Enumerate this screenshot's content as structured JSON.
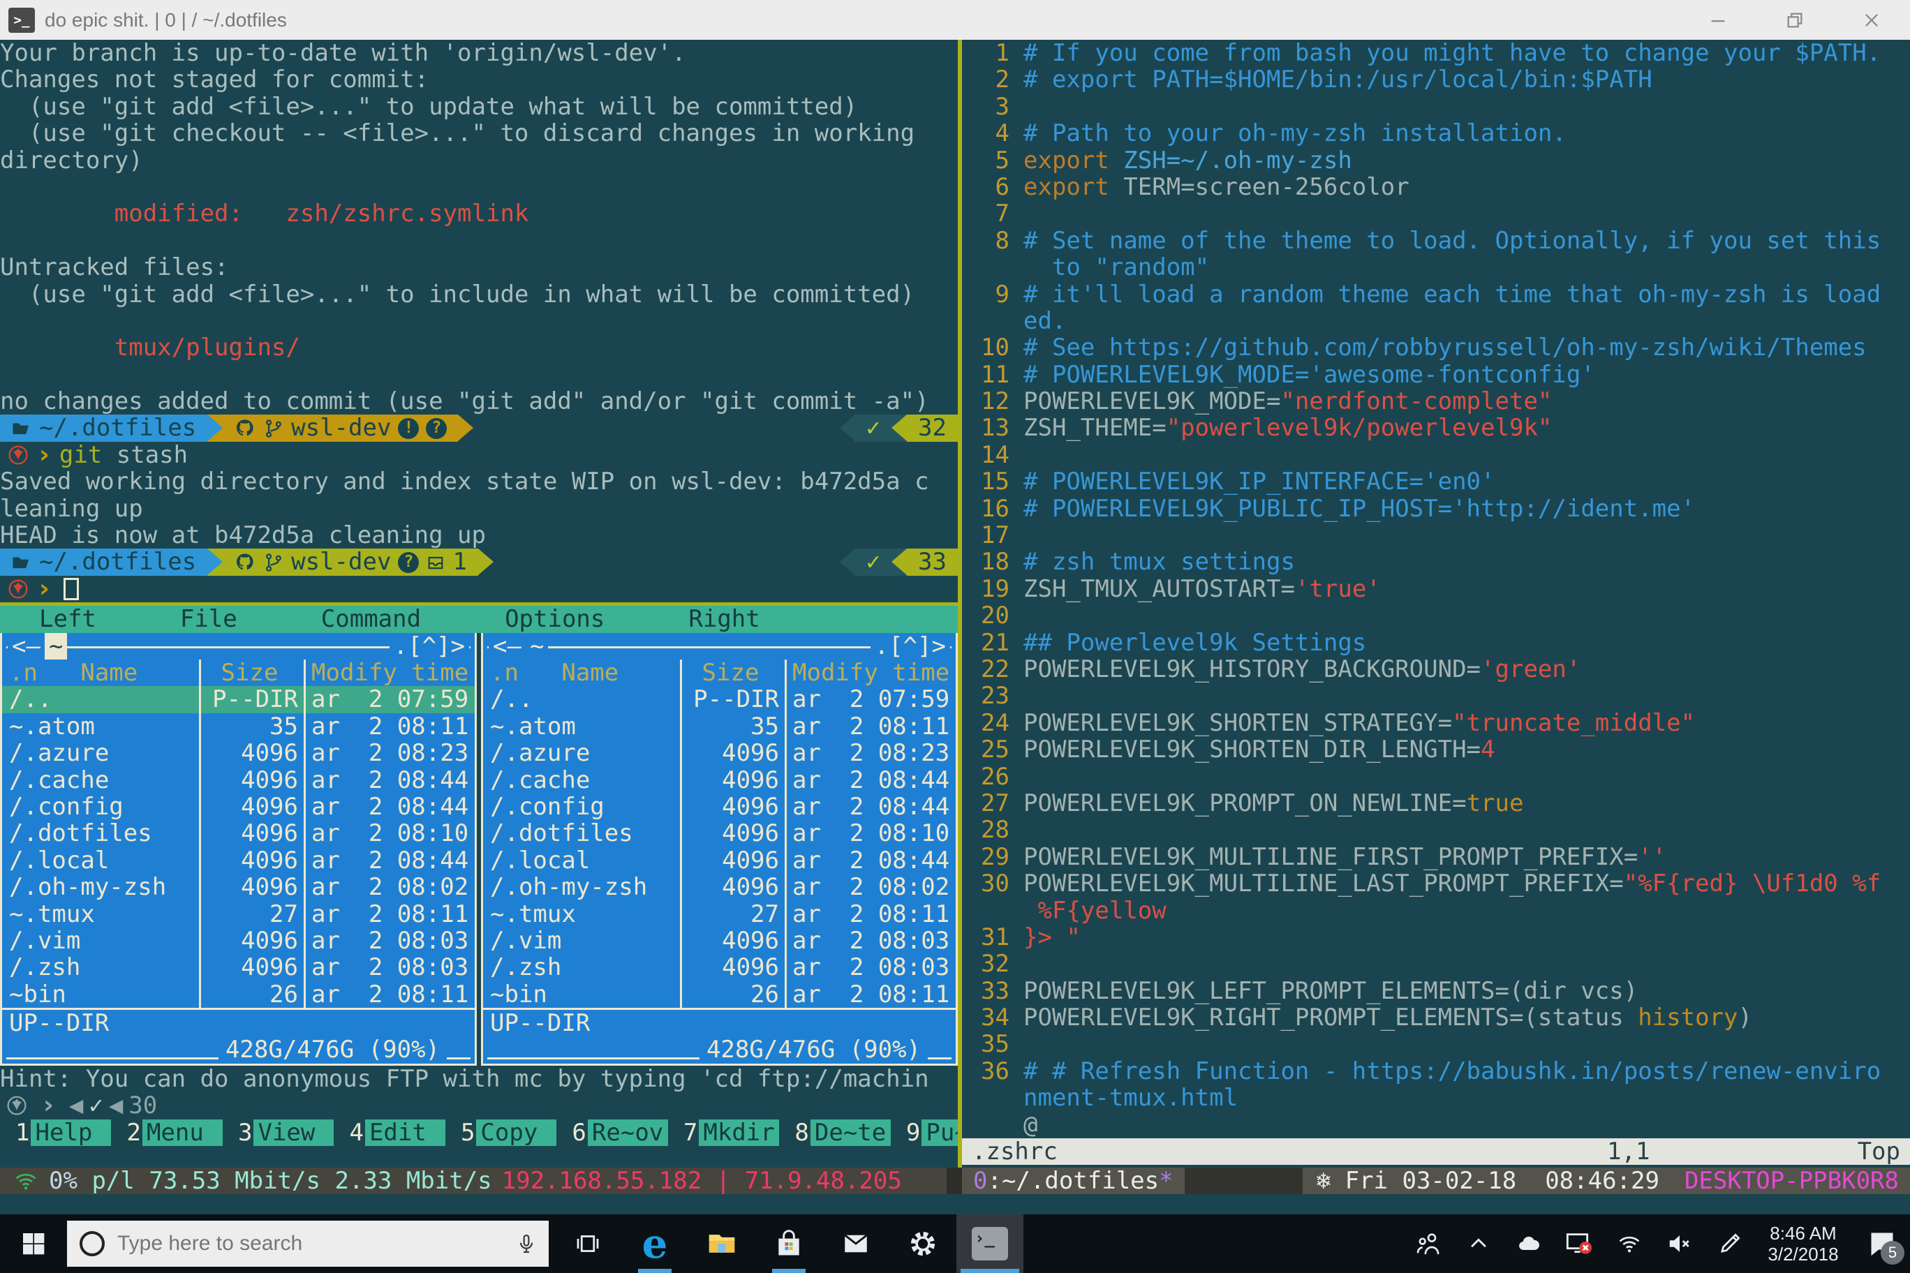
{
  "colors": {
    "terminal_bg": "#1a4550",
    "accent_blue": "#2e96d8",
    "gold": "#c1980f",
    "olive_green": "#a9b21b",
    "mc_blue": "#1f80d3",
    "mc_teal": "#3bb294",
    "error_red": "#dd5044",
    "magenta": "#e44ad4",
    "pane_border": "#a8b31c",
    "taskbar_underline": "#4f9fd8"
  },
  "titlebar": {
    "title": "do epic shit. | 0 | / ~/.dotfiles"
  },
  "git": {
    "output_top": [
      {
        "t": "Your branch is up-to-date with 'origin/wsl-dev'.",
        "c": "fg"
      },
      {
        "t": "Changes not staged for commit:",
        "c": "fg"
      },
      {
        "t": "  (use \"git add <file>...\" to update what will be committed)",
        "c": "fg"
      },
      {
        "t": "  (use \"git checkout -- <file>...\" to discard changes in working",
        "c": "fg"
      },
      {
        "t": "directory)",
        "c": "fg"
      },
      {
        "t": "",
        "c": "fg"
      },
      {
        "t": "        modified:   zsh/zshrc.symlink",
        "c": "red"
      },
      {
        "t": "",
        "c": "fg"
      },
      {
        "t": "Untracked files:",
        "c": "fg"
      },
      {
        "t": "  (use \"git add <file>...\" to include in what will be committed)",
        "c": "fg"
      },
      {
        "t": "",
        "c": "fg"
      },
      {
        "t": "        tmux/plugins/",
        "c": "red"
      },
      {
        "t": "",
        "c": "fg"
      },
      {
        "t": "no changes added to commit (use \"git add\" and/or \"git commit -a\")",
        "c": "fg"
      }
    ],
    "prompt1": {
      "dir": "~/.dotfiles",
      "branch": "wsl-dev",
      "badge_a": "!",
      "badge_b": "?",
      "check": "✓",
      "history": "32"
    },
    "command": {
      "cmd": "git",
      "args": " stash",
      "prompt_char": "›"
    },
    "output_mid": [
      "Saved working directory and index state WIP on wsl-dev: b472d5a c",
      "leaning up",
      "HEAD is now at b472d5a cleaning up"
    ],
    "prompt2": {
      "dir": "~/.dotfiles",
      "branch": "wsl-dev",
      "badge_a": "?",
      "stash_count": "1",
      "check": "✓",
      "history": "33"
    }
  },
  "mc": {
    "menu": [
      "Left",
      "File",
      "Command",
      "Options",
      "Right"
    ],
    "panels": [
      {
        "left_arrow": "<—",
        "path": "~",
        "active": true,
        "dots": ".[^]>"
      },
      {
        "left_arrow": "<—",
        "path": "~",
        "active": false,
        "dots": ".[^]>"
      }
    ],
    "headers": [
      ".n   Name",
      "Size",
      "Modify time"
    ],
    "rows": [
      [
        "/..",
        "P--DIR",
        "ar  2 07:59"
      ],
      [
        "~.atom",
        "35",
        "ar  2 08:11"
      ],
      [
        "/.azure",
        "4096",
        "ar  2 08:23"
      ],
      [
        "/.cache",
        "4096",
        "ar  2 08:44"
      ],
      [
        "/.config",
        "4096",
        "ar  2 08:44"
      ],
      [
        "/.dotfiles",
        "4096",
        "ar  2 08:10"
      ],
      [
        "/.local",
        "4096",
        "ar  2 08:44"
      ],
      [
        "/.oh-my-zsh",
        "4096",
        "ar  2 08:02"
      ],
      [
        "~.tmux",
        "27",
        "ar  2 08:11"
      ],
      [
        "/.vim",
        "4096",
        "ar  2 08:03"
      ],
      [
        "/.zsh",
        "4096",
        "ar  2 08:03"
      ],
      [
        "~bin",
        "26",
        "ar  2 08:11"
      ]
    ],
    "selected_row": 0,
    "ministatus": "UP--DIR",
    "disk": "428G/476G (90%)",
    "hint": "Hint: You can do anonymous FTP with mc by typing 'cd ftp://machin",
    "subshell_prompt": {
      "prompt_char": "›",
      "arrow": "◀",
      "check": "✓",
      "history": "30"
    },
    "fkeys": [
      [
        "1",
        "Help"
      ],
      [
        "2",
        "Menu"
      ],
      [
        "3",
        "View"
      ],
      [
        "4",
        "Edit"
      ],
      [
        "5",
        "Copy"
      ],
      [
        "6",
        "Re~ov"
      ],
      [
        "7",
        "Mkdir"
      ],
      [
        "8",
        "De~te"
      ],
      [
        "9",
        "Pu~Dn"
      ]
    ]
  },
  "vim": {
    "rows": [
      {
        "num": "1",
        "seg": [
          [
            "# If you come from bash you might have to change your $PATH.",
            "vc"
          ]
        ]
      },
      {
        "num": "2",
        "seg": [
          [
            "# export PATH=$HOME/bin:/usr/local/bin:$PATH",
            "vc"
          ]
        ]
      },
      {
        "num": "3",
        "seg": []
      },
      {
        "num": "4",
        "seg": [
          [
            "# Path to your oh-my-zsh installation.",
            "vc"
          ]
        ]
      },
      {
        "num": "5",
        "seg": [
          [
            "export ",
            "vk"
          ],
          [
            "ZSH=~/.oh-my-zsh",
            "vb"
          ]
        ]
      },
      {
        "num": "6",
        "seg": [
          [
            "export ",
            "vk"
          ],
          [
            "TERM=screen-256color",
            "vp"
          ]
        ]
      },
      {
        "num": "7",
        "seg": []
      },
      {
        "num": "8",
        "seg": [
          [
            "# Set name of the theme to load. Optionally, if you set this",
            "vc"
          ]
        ]
      },
      {
        "num": "",
        "seg": [
          [
            "  to \"random\"",
            "vc"
          ]
        ]
      },
      {
        "num": "9",
        "seg": [
          [
            "# it'll load a random theme each time that oh-my-zsh is load",
            "vc"
          ]
        ]
      },
      {
        "num": "",
        "seg": [
          [
            "ed.",
            "vc"
          ]
        ]
      },
      {
        "num": "10",
        "seg": [
          [
            "# See https://github.com/robbyrussell/oh-my-zsh/wiki/Themes",
            "vc"
          ]
        ]
      },
      {
        "num": "11",
        "seg": [
          [
            "# POWERLEVEL9K_MODE='awesome-fontconfig'",
            "vc"
          ]
        ]
      },
      {
        "num": "12",
        "seg": [
          [
            "POWERLEVEL9K_MODE=",
            "vp"
          ],
          [
            "\"nerdfont-complete\"",
            "vs"
          ]
        ]
      },
      {
        "num": "13",
        "seg": [
          [
            "ZSH_THEME=",
            "vp"
          ],
          [
            "\"powerlevel9k/powerlevel9k\"",
            "vs"
          ]
        ]
      },
      {
        "num": "14",
        "seg": []
      },
      {
        "num": "15",
        "seg": [
          [
            "# POWERLEVEL9K_IP_INTERFACE='en0'",
            "vc"
          ]
        ]
      },
      {
        "num": "16",
        "seg": [
          [
            "# POWERLEVEL9K_PUBLIC_IP_HOST='http://ident.me'",
            "vc"
          ]
        ]
      },
      {
        "num": "17",
        "seg": []
      },
      {
        "num": "18",
        "seg": [
          [
            "# zsh tmux settings",
            "vc"
          ]
        ]
      },
      {
        "num": "19",
        "seg": [
          [
            "ZSH_TMUX_AUTOSTART=",
            "vp"
          ],
          [
            "'true'",
            "vs"
          ]
        ]
      },
      {
        "num": "20",
        "seg": []
      },
      {
        "num": "21",
        "seg": [
          [
            "## Powerlevel9k Settings",
            "vc"
          ]
        ]
      },
      {
        "num": "22",
        "seg": [
          [
            "POWERLEVEL9K_HISTORY_BACKGROUND=",
            "vp"
          ],
          [
            "'green'",
            "vs"
          ]
        ]
      },
      {
        "num": "23",
        "seg": []
      },
      {
        "num": "24",
        "seg": [
          [
            "POWERLEVEL9K_SHORTEN_STRATEGY=",
            "vp"
          ],
          [
            "\"truncate_middle\"",
            "vs"
          ]
        ]
      },
      {
        "num": "25",
        "seg": [
          [
            "POWERLEVEL9K_SHORTEN_DIR_LENGTH=",
            "vp"
          ],
          [
            "4",
            "vs"
          ]
        ]
      },
      {
        "num": "26",
        "seg": []
      },
      {
        "num": "27",
        "seg": [
          [
            "POWERLEVEL9K_PROMPT_ON_NEWLINE=",
            "vp"
          ],
          [
            "true",
            "vo"
          ]
        ]
      },
      {
        "num": "28",
        "seg": []
      },
      {
        "num": "29",
        "seg": [
          [
            "POWERLEVEL9K_MULTILINE_FIRST_PROMPT_PREFIX=",
            "vp"
          ],
          [
            "''",
            "vs"
          ]
        ]
      },
      {
        "num": "30",
        "seg": [
          [
            "POWERLEVEL9K_MULTILINE_LAST_PROMPT_PREFIX=",
            "vp"
          ],
          [
            "\"%F{red} \\Uf1d0 %f",
            "vs"
          ]
        ]
      },
      {
        "num": "",
        "seg": [
          [
            " %F{yellow",
            "vs"
          ]
        ]
      },
      {
        "num": "31",
        "seg": [
          [
            "}> \"",
            "vs"
          ]
        ]
      },
      {
        "num": "32",
        "seg": []
      },
      {
        "num": "33",
        "seg": [
          [
            "POWERLEVEL9K_LEFT_PROMPT_ELEMENTS=(dir vcs)",
            "vp"
          ]
        ]
      },
      {
        "num": "34",
        "seg": [
          [
            "POWERLEVEL9K_RIGHT_PROMPT_ELEMENTS=(status ",
            "vp"
          ],
          [
            "history",
            "vo"
          ],
          [
            ")",
            "vp"
          ]
        ]
      },
      {
        "num": "35",
        "seg": []
      },
      {
        "num": "36",
        "seg": [
          [
            "# # Refresh Function - https://babushk.in/posts/renew-enviro",
            "vc"
          ]
        ]
      },
      {
        "num": "",
        "seg": [
          [
            "nment-tmux.html",
            "vc"
          ]
        ]
      },
      {
        "num": "",
        "seg": [
          [
            "@",
            "vp"
          ]
        ]
      }
    ],
    "statusline": {
      "file": ".zshrc",
      "position": "1,1",
      "scroll": "Top"
    }
  },
  "tmux": {
    "net": {
      "percent": "0%",
      "label": "p/l",
      "down": "73.53 Mbit/s",
      "up": "2.33 Mbit/s",
      "ip_local": "192.168.55.182",
      "sep": "|",
      "ip_public": "71.9.48.205"
    },
    "window": {
      "index": "0",
      "name": ":~/.dotfiles",
      "flag": "*"
    },
    "date": "❄ Fri 03-02-18  08:46:29",
    "host": "DESKTOP-PPBK0R8"
  },
  "taskbar": {
    "search_placeholder": "Type here to search",
    "clock": {
      "time": "8:46 AM",
      "date": "3/2/2018"
    },
    "notification_count": "5"
  }
}
